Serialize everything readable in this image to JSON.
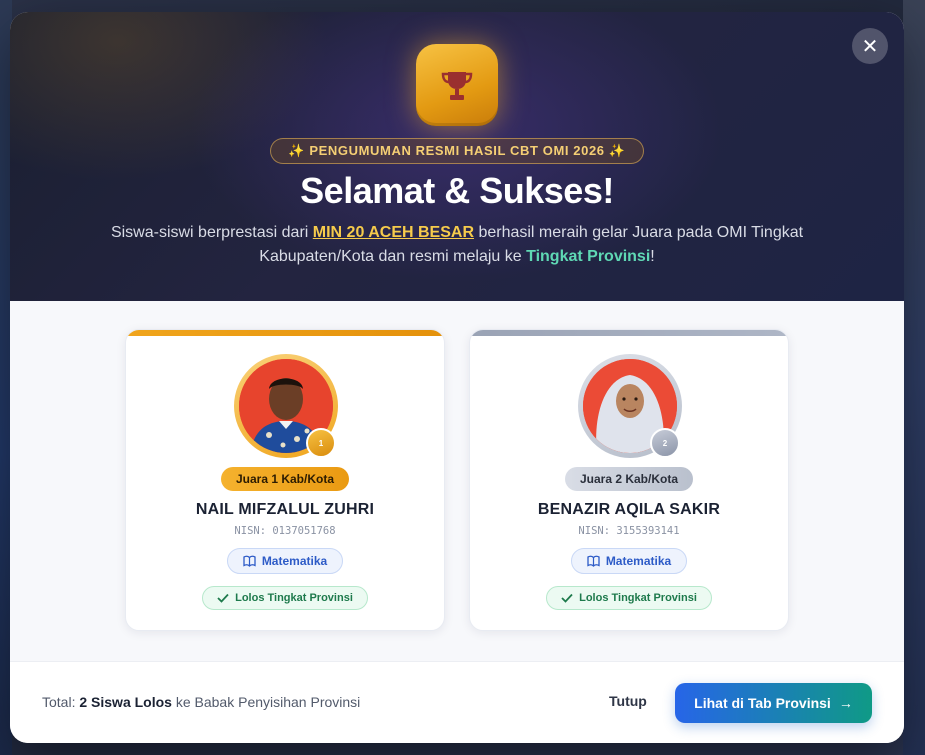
{
  "modal": {
    "close_glyph": "✕",
    "announcement": "✨ PENGUMUMAN RESMI HASIL CBT OMI 2026 ✨",
    "title": "Selamat & Sukses!",
    "description": {
      "part1": "Siswa-siswi berprestasi dari ",
      "school": "MIN 20 ACEH BESAR",
      "part2": " berhasil meraih gelar Juara pada OMI Tingkat Kabupaten/Kota dan resmi melaju ke ",
      "level": "Tingkat Provinsi",
      "part3": "!"
    }
  },
  "students": [
    {
      "rank_label": "Juara 1 Kab/Kota",
      "medal_number": "1",
      "name": "NAIL MIFZALUL ZUHRI",
      "nisn": "NISN: 0137051768",
      "subject": "Matematika",
      "status": "Lolos Tingkat Provinsi"
    },
    {
      "rank_label": "Juara 2 Kab/Kota",
      "medal_number": "2",
      "name": "BENAZIR AQILA SAKIR",
      "nisn": "NISN: 3155393141",
      "subject": "Matematika",
      "status": "Lolos Tingkat Provinsi"
    }
  ],
  "footer": {
    "total_prefix": "Total: ",
    "total_count": "2 Siswa Lolos",
    "total_suffix": " ke Babak Penyisihan Provinsi",
    "close_label": "Tutup",
    "cta_label": "Lihat di Tab Provinsi",
    "cta_arrow": "→"
  },
  "icons": {
    "trophy": "trophy-icon",
    "close": "close-icon",
    "book": "book-icon",
    "check": "check-icon",
    "medal": "medal-icon"
  },
  "colors": {
    "gold": "#f0a51c",
    "silver": "#aeb6c6",
    "subject_blue": "#2d5bc7",
    "pass_green": "#1e7a4c",
    "cta_start": "#2765e8",
    "cta_end": "#0f9a86"
  }
}
